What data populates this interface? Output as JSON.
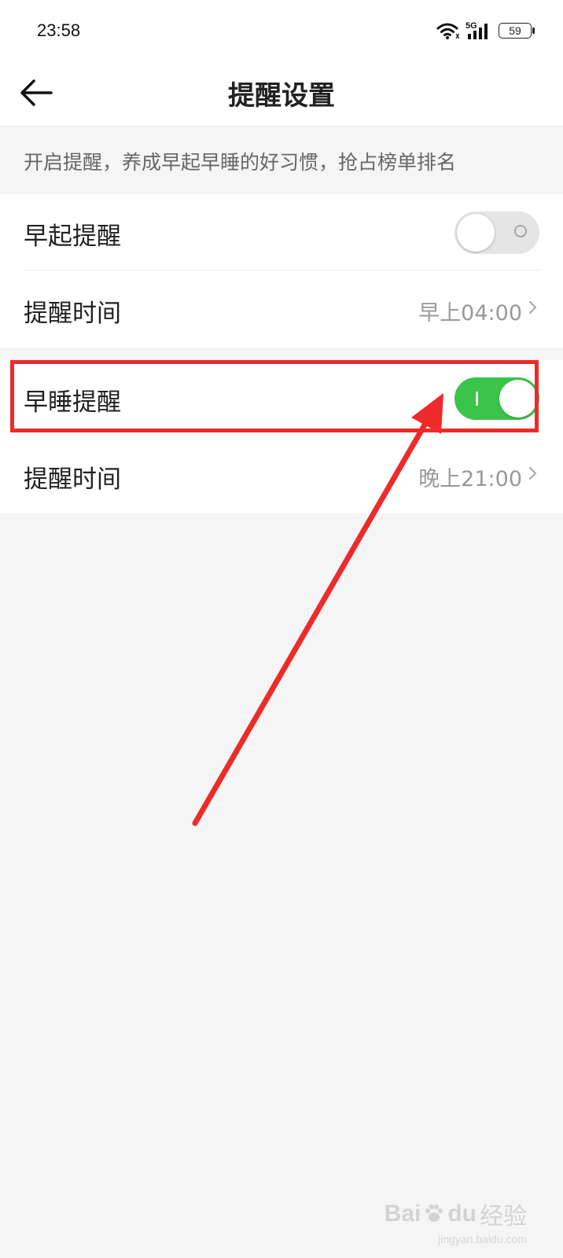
{
  "status_bar": {
    "time": "23:58",
    "network": "5G",
    "battery": "59",
    "icons": [
      "wifi-icon",
      "5g-signal-icon",
      "battery-icon"
    ]
  },
  "header": {
    "title": "提醒设置",
    "back_icon": "arrow-left-icon"
  },
  "hint": {
    "text": "开启提醒，养成早起早睡的好习惯，抢占榜单排名"
  },
  "sections": [
    {
      "toggle": {
        "label": "早起提醒",
        "on": false
      },
      "time": {
        "label": "提醒时间",
        "value": "早上04:00"
      }
    },
    {
      "toggle": {
        "label": "早睡提醒",
        "on": true
      },
      "time": {
        "label": "提醒时间",
        "value": "晚上21:00"
      }
    }
  ],
  "colors": {
    "switch_on": "#3bc44a",
    "switch_off": "#e5e5e5",
    "annotation": "#ee2a2a",
    "background": "#f5f5f5"
  },
  "watermark": {
    "brand": "Bai",
    "brand_suffix": "du",
    "name": "经验",
    "url": "jingyan.baidu.com"
  }
}
